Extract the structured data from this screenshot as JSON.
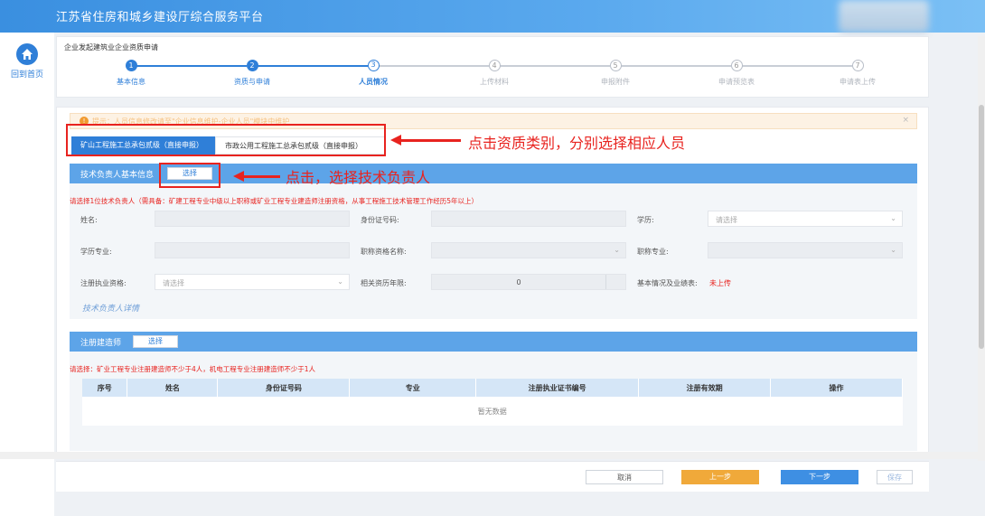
{
  "header": {
    "site_title": "江苏省住房和城乡建设厅综合服务平台"
  },
  "nav": {
    "home_label": "回到首页"
  },
  "breadcrumb": "企业发起建筑业企业资质申请",
  "steps": [
    {
      "num": "1",
      "label": "基本信息",
      "state": "done"
    },
    {
      "num": "2",
      "label": "资质与申请",
      "state": "done"
    },
    {
      "num": "3",
      "label": "人员情况",
      "state": "current"
    },
    {
      "num": "4",
      "label": "上传材料",
      "state": "todo"
    },
    {
      "num": "5",
      "label": "申报附件",
      "state": "todo"
    },
    {
      "num": "6",
      "label": "申请预览表",
      "state": "todo"
    },
    {
      "num": "7",
      "label": "申请表上传",
      "state": "todo"
    }
  ],
  "tip": {
    "text": "提示：人员信息修改请至\"企业信息维护-企业人员\"模块中维护"
  },
  "tabs": [
    {
      "label": "矿山工程施工总承包贰级（直接申报）",
      "active": true
    },
    {
      "label": "市政公用工程施工总承包贰级（直接申报）",
      "active": false
    }
  ],
  "annotations": {
    "tabs_note": "点击资质类别，分别选择相应人员",
    "select_note": "点击，选择技术负责人"
  },
  "tech_lead": {
    "title": "技术负责人基本信息",
    "select_btn": "选择",
    "requirement": "请选择1位技术负责人（需具备：矿建工程专业中级以上职称或矿业工程专业建造师注册资格，从事工程施工技术管理工作经历5年以上）",
    "fields": {
      "name_label": "姓名:",
      "id_label": "身份证号码:",
      "edu_label": "学历:",
      "edu_placeholder": "请选择",
      "major_label": "学历专业:",
      "title_label": "职称资格名称:",
      "title_major_label": "职称专业:",
      "reg_label": "注册执业资格:",
      "reg_placeholder": "请选择",
      "years_label": "相关资历年限:",
      "years_value": "0",
      "perf_label": "基本情况及业绩表:",
      "perf_status": "未上传"
    },
    "detail_link": "技术负责人详情"
  },
  "builders": {
    "title": "注册建造师",
    "select_btn": "选择",
    "requirement": "请选择：矿业工程专业注册建造师不少于4人，机电工程专业注册建造师不少于1人",
    "columns": [
      "序号",
      "姓名",
      "身份证号码",
      "专业",
      "注册执业证书编号",
      "注册有效期",
      "操作"
    ],
    "empty": "暂无数据"
  },
  "footer": {
    "cancel": "取消",
    "prev": "上一步",
    "next": "下一步",
    "save": "保存"
  },
  "colors": {
    "primary": "#2f7fd8",
    "section": "#5da4e8",
    "warning": "#e8231f",
    "prev_btn": "#f0a93a"
  }
}
